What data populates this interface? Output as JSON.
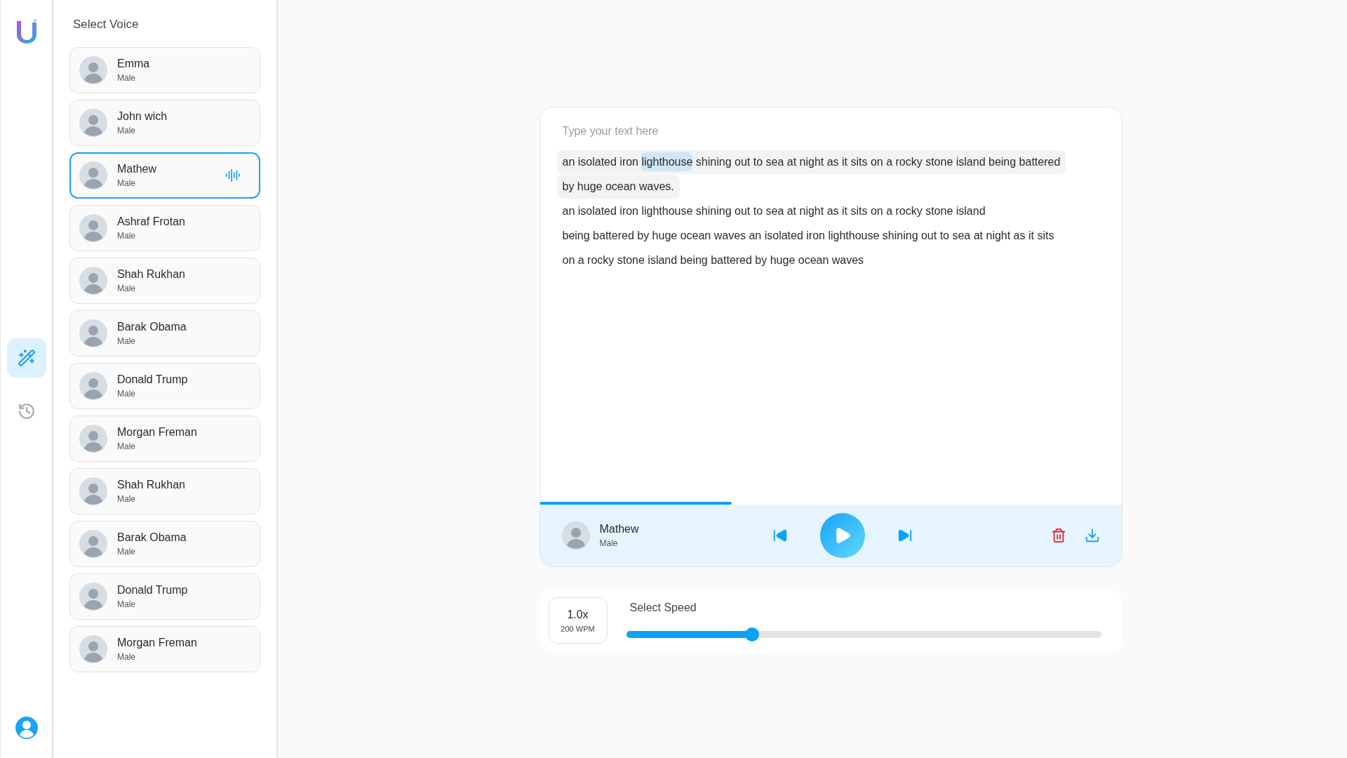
{
  "nav": {
    "items": [
      {
        "kind": "wand",
        "selected": true
      },
      {
        "kind": "history",
        "selected": false
      }
    ]
  },
  "voice_panel": {
    "title": "Select Voice",
    "voices": [
      {
        "name": "Emma",
        "gender": "Male",
        "selected": false
      },
      {
        "name": "John wich",
        "gender": "Male",
        "selected": false
      },
      {
        "name": "Mathew",
        "gender": "Male",
        "selected": true
      },
      {
        "name": "Ashraf Frotan",
        "gender": "Male",
        "selected": false
      },
      {
        "name": "Shah Rukhan",
        "gender": "Male",
        "selected": false
      },
      {
        "name": "Barak Obama",
        "gender": "Male",
        "selected": false
      },
      {
        "name": "Donald Trump",
        "gender": "Male",
        "selected": false
      },
      {
        "name": "Morgan Freman",
        "gender": "Male",
        "selected": false
      },
      {
        "name": "Shah Rukhan",
        "gender": "Male",
        "selected": false
      },
      {
        "name": "Barak Obama",
        "gender": "Male",
        "selected": false
      },
      {
        "name": "Donald Trump",
        "gender": "Male",
        "selected": false
      },
      {
        "name": "Morgan Freman",
        "gender": "Male",
        "selected": false
      }
    ]
  },
  "editor": {
    "placeholder": "Type your text here",
    "lines": [
      {
        "active": true,
        "segments": [
          {
            "text": "an isolated iron ",
            "highlighted": false
          },
          {
            "text": "lighthouse",
            "highlighted": true
          },
          {
            "text": " shining out to sea at night as it sits on a rocky stone island being battered",
            "highlighted": false
          }
        ]
      },
      {
        "active": true,
        "segments": [
          {
            "text": "by huge ocean waves.",
            "highlighted": false
          }
        ]
      },
      {
        "active": false,
        "segments": [
          {
            "text": "an isolated iron lighthouse shining out to sea at night as it sits on a rocky stone island",
            "highlighted": false
          }
        ]
      },
      {
        "active": false,
        "segments": [
          {
            "text": "being battered by huge ocean waves an isolated iron lighthouse shining out to sea at night as it sits",
            "highlighted": false
          }
        ]
      },
      {
        "active": false,
        "segments": [
          {
            "text": "on a rocky stone island being battered by huge ocean waves",
            "highlighted": false
          }
        ]
      }
    ],
    "progress": {
      "level": 0.33
    }
  },
  "player": {
    "name": "Mathew",
    "gender": "Male",
    "playing": false
  },
  "speed": {
    "value": "1.0x",
    "wpm": "200 WPM",
    "label": "Select Speed",
    "level": 0.265
  }
}
